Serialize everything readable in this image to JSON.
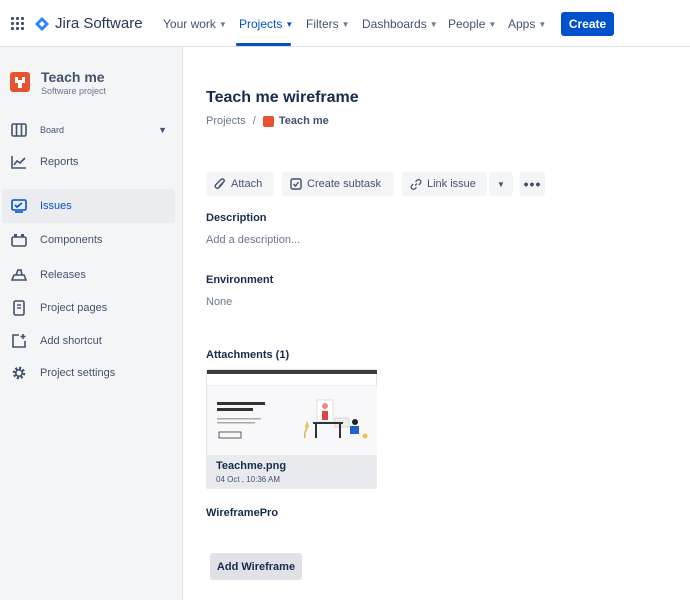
{
  "topnav": {
    "product": "Jira Software",
    "items": [
      {
        "label": "Your work"
      },
      {
        "label": "Projects"
      },
      {
        "label": "Filters"
      },
      {
        "label": "Dashboards"
      },
      {
        "label": "People"
      },
      {
        "label": "Apps"
      }
    ],
    "create_label": "Create",
    "accent": "#0052cc"
  },
  "sidebar": {
    "project_name": "Teach me",
    "project_type": "Software project",
    "items": [
      {
        "label": "Board",
        "icon": "board-icon"
      },
      {
        "label": "Reports",
        "icon": "reports-icon"
      },
      {
        "label": "Issues",
        "icon": "issues-icon"
      },
      {
        "label": "Components",
        "icon": "components-icon"
      },
      {
        "label": "Releases",
        "icon": "releases-icon"
      },
      {
        "label": "Project pages",
        "icon": "pages-icon"
      },
      {
        "label": "Add shortcut",
        "icon": "add-shortcut-icon"
      },
      {
        "label": "Project settings",
        "icon": "settings-icon"
      }
    ]
  },
  "main": {
    "title": "Teach me wireframe",
    "breadcrumb": {
      "root": "Projects",
      "separator": "/",
      "current": "Teach me"
    },
    "actions": {
      "attach": "Attach",
      "create_subtask": "Create subtask",
      "link_issue": "Link issue"
    },
    "description": {
      "heading": "Description",
      "placeholder": "Add a description..."
    },
    "environment": {
      "heading": "Environment",
      "value": "None"
    },
    "attachments": {
      "heading": "Attachments (1)",
      "file_name": "Teachme.png",
      "file_date": "04 Oct , 10:36 AM"
    },
    "wireframepro": {
      "heading": "WireframePro",
      "button": "Add Wireframe"
    }
  }
}
